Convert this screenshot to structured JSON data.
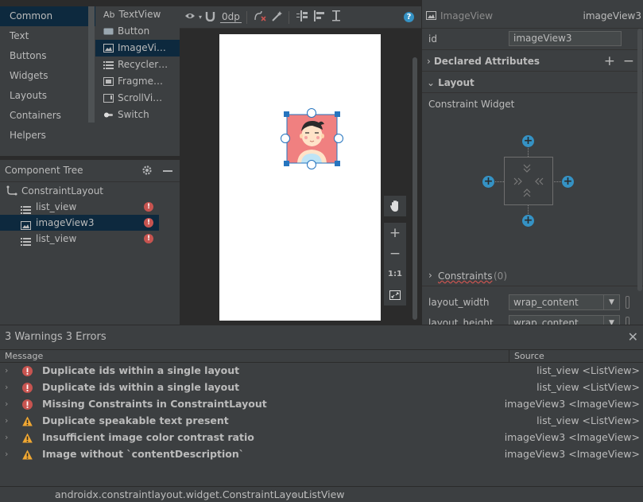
{
  "palette": {
    "categories": [
      "Common",
      "Text",
      "Buttons",
      "Widgets",
      "Layouts",
      "Containers",
      "Helpers"
    ],
    "selected_category": "Common",
    "widgets": [
      {
        "label": "TextView",
        "icon": "ab-icon"
      },
      {
        "label": "Button",
        "icon": "button-icon"
      },
      {
        "label": "ImageVi…",
        "icon": "image-icon"
      },
      {
        "label": "Recycler…",
        "icon": "list-icon"
      },
      {
        "label": "Fragme…",
        "icon": "fragment-icon"
      },
      {
        "label": "ScrollVi…",
        "icon": "scrollview-icon"
      },
      {
        "label": "Switch",
        "icon": "switch-icon"
      }
    ],
    "textview_prefix": "Ab"
  },
  "tree": {
    "title": "Component Tree",
    "root": "ConstraintLayout",
    "items": [
      "list_view",
      "imageView3",
      "list_view"
    ],
    "error_mark": "!"
  },
  "toolbar": {
    "margin_value": "0dp",
    "help": "?"
  },
  "zoom": {
    "plus": "+",
    "minus": "−",
    "one_to_one": "1:1"
  },
  "attributes": {
    "widget_type": "ImageView",
    "widget_id": "imageView3",
    "id_label": "id",
    "id_value": "imageView3",
    "declared_attributes": "Declared Attributes",
    "layout_section": "Layout",
    "constraint_widget": "Constraint Widget",
    "constraints_label": "Constraints",
    "constraints_count": "(0)",
    "layout_width_label": "layout_width",
    "layout_width_value": "wrap_content",
    "layout_height_label": "layout_height",
    "layout_height_value": "wrap_content",
    "add": "+",
    "remove": "−"
  },
  "problems": {
    "summary": "3 Warnings 3 Errors",
    "col_message": "Message",
    "col_source": "Source",
    "rows": [
      {
        "severity": "error",
        "message": "Duplicate ids within a single layout",
        "source": "list_view <ListView>"
      },
      {
        "severity": "error",
        "message": "Duplicate ids within a single layout",
        "source": "list_view <ListView>"
      },
      {
        "severity": "error",
        "message": "Missing Constraints in ConstraintLayout",
        "source": "imageView3 <ImageView>"
      },
      {
        "severity": "warning",
        "message": "Duplicate speakable text present",
        "source": "list_view <ListView>"
      },
      {
        "severity": "warning",
        "message": "Insufficient image color contrast ratio",
        "source": "imageView3 <ImageView>"
      },
      {
        "severity": "warning",
        "message": "Image without `contentDescription`",
        "source": "imageView3 <ImageView>"
      }
    ],
    "colors": {
      "error": "#c75450",
      "warning": "#f0a732"
    }
  },
  "status": {
    "path": "androidx.constraintlayout.widget.ConstraintLayout",
    "separator": "›",
    "current": "ListView"
  },
  "colors": {
    "accent_blue": "#3592c4",
    "selection": "#0d293e",
    "handle_blue": "#2675bf",
    "avatar_bg": "#f08080"
  }
}
